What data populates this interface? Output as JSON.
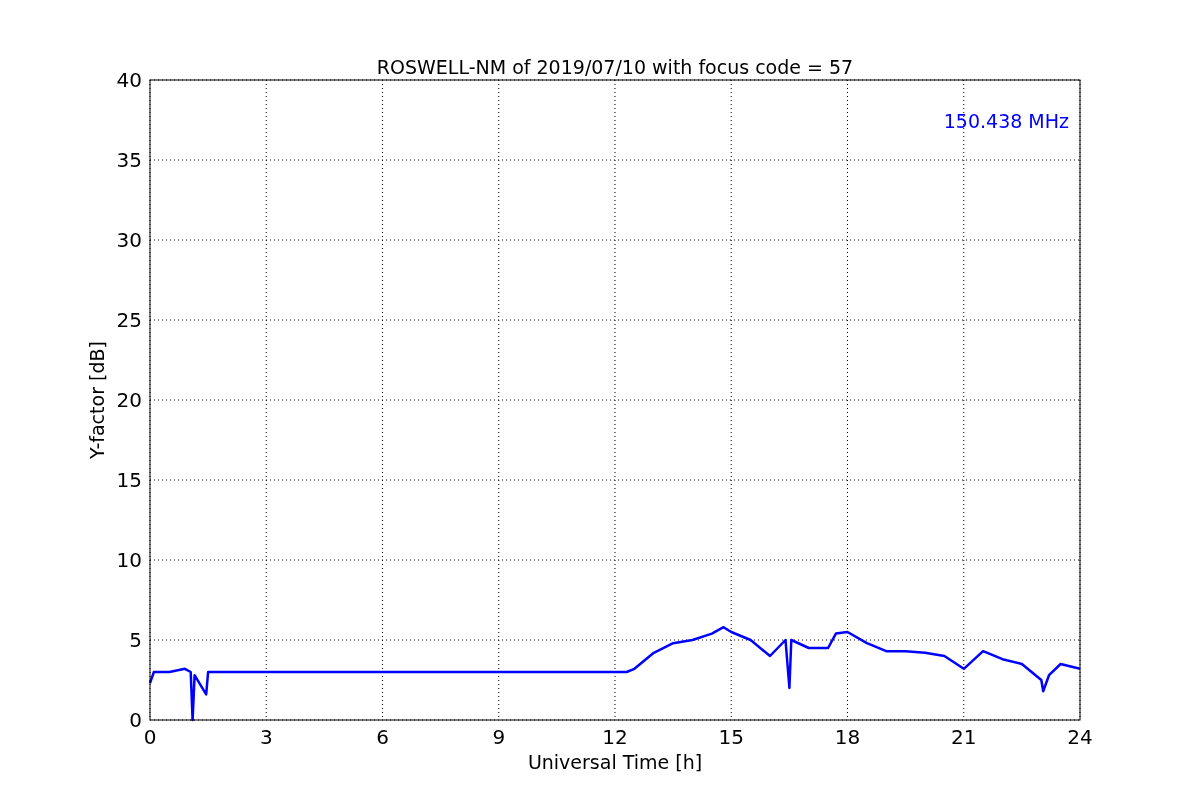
{
  "chart_data": {
    "type": "line",
    "title": "ROSWELL-NM of 2019/07/10 with focus code = 57",
    "xlabel": "Universal Time [h]",
    "ylabel": "Y-factor [dB]",
    "x": [
      0,
      0.1,
      0.5,
      0.9,
      1.05,
      1.1,
      1.15,
      1.3,
      1.45,
      1.5,
      12.3,
      12.5,
      13,
      13.5,
      14,
      14.5,
      14.8,
      15,
      15.5,
      16,
      16.4,
      16.5,
      16.55,
      17,
      17.5,
      17.7,
      18,
      18.5,
      19,
      19.5,
      20,
      20.5,
      21,
      21.5,
      22,
      22.5,
      23,
      23.05,
      23.2,
      23.5,
      24
    ],
    "series": [
      {
        "name": "150.438 MHz",
        "color": "#0000ff",
        "values": [
          2.3,
          3.0,
          3.0,
          3.2,
          3.0,
          0,
          2.8,
          2.2,
          1.6,
          3.0,
          3.0,
          3.2,
          4.2,
          4.8,
          5.0,
          5.4,
          5.8,
          5.5,
          5.0,
          4.0,
          5.0,
          2.0,
          5.0,
          4.5,
          4.5,
          5.4,
          5.5,
          4.8,
          4.3,
          4.3,
          4.2,
          4.0,
          3.2,
          4.3,
          3.8,
          3.5,
          2.5,
          1.8,
          2.8,
          3.5,
          3.2
        ]
      }
    ],
    "xlim": [
      0,
      24
    ],
    "ylim": [
      0,
      40
    ],
    "xticks": [
      0,
      3,
      6,
      9,
      12,
      15,
      18,
      21,
      24
    ],
    "yticks": [
      0,
      5,
      10,
      15,
      20,
      25,
      30,
      35,
      40
    ],
    "grid": true
  }
}
